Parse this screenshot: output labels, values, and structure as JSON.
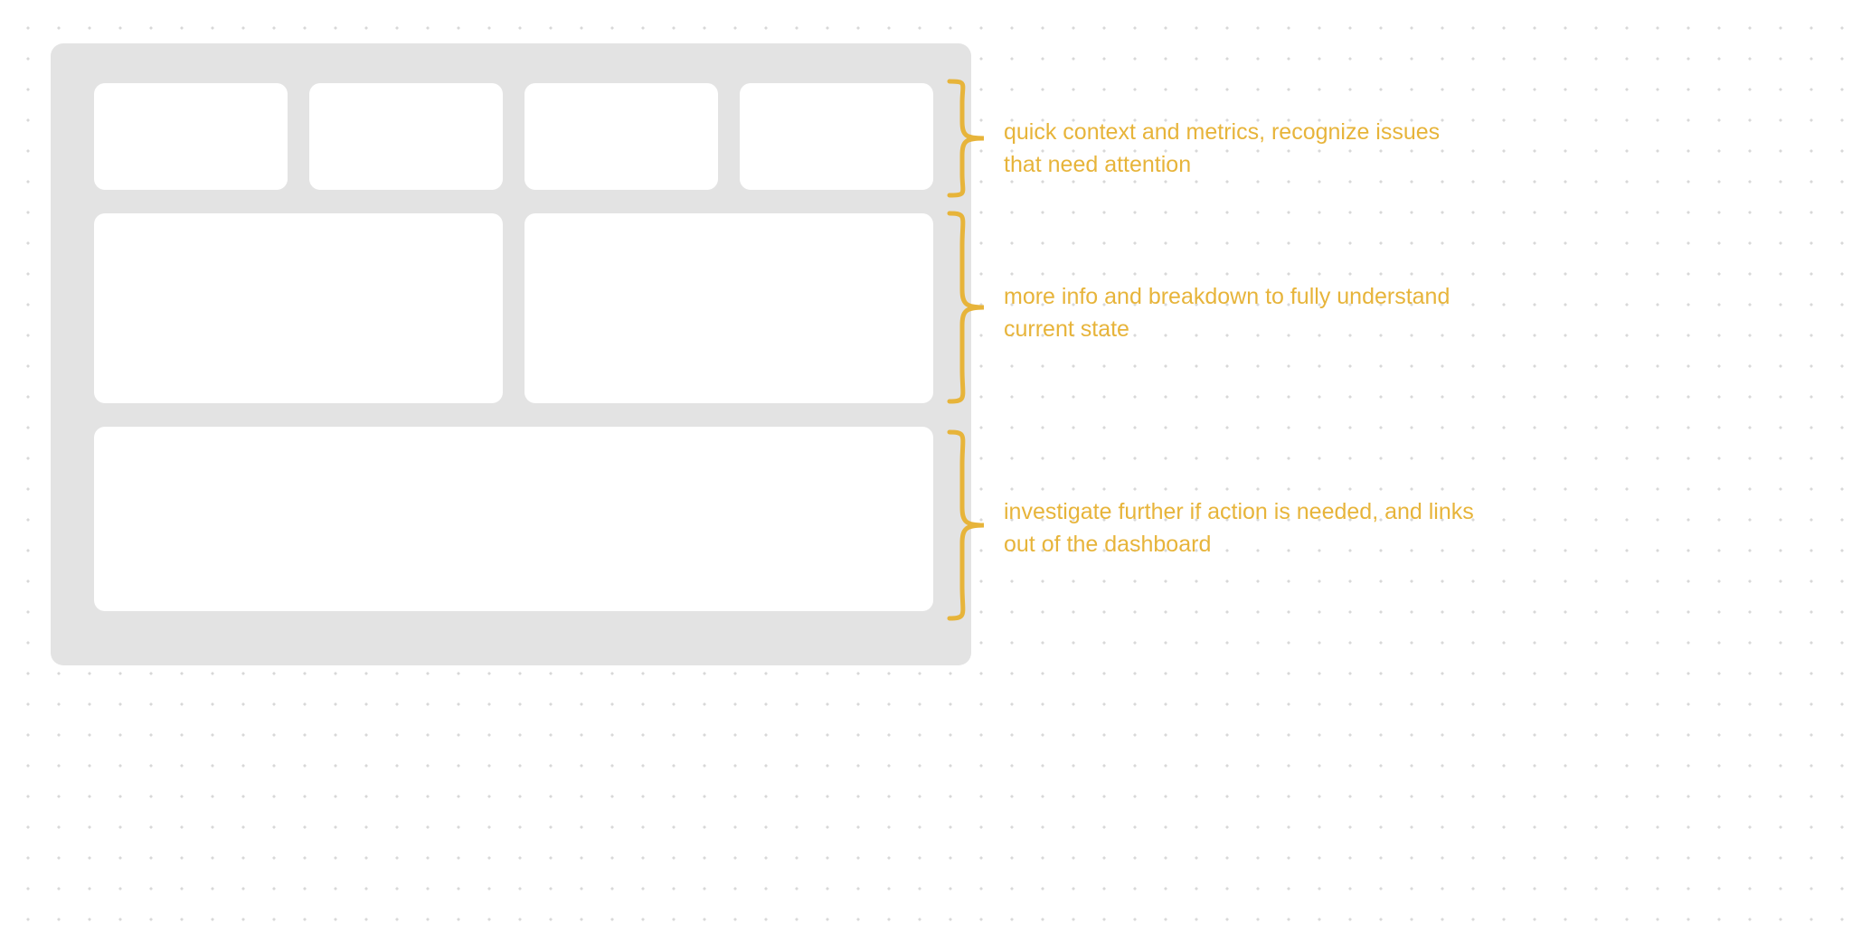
{
  "annotations": {
    "row1": "quick context and metrics, recognize issues that need attention",
    "row2": "more info and breakdown to fully understand current state",
    "row3": "investigate further if action is needed, and links out of the dashboard"
  },
  "colors": {
    "accent": "#e7b43a",
    "wireframe_bg": "#e3e3e3",
    "card_bg": "#ffffff",
    "dot": "#d8d8d8"
  },
  "layout": {
    "rows": [
      {
        "name": "metrics-row",
        "card_count": 4
      },
      {
        "name": "breakdown-row",
        "card_count": 2
      },
      {
        "name": "investigate-row",
        "card_count": 1
      }
    ]
  }
}
